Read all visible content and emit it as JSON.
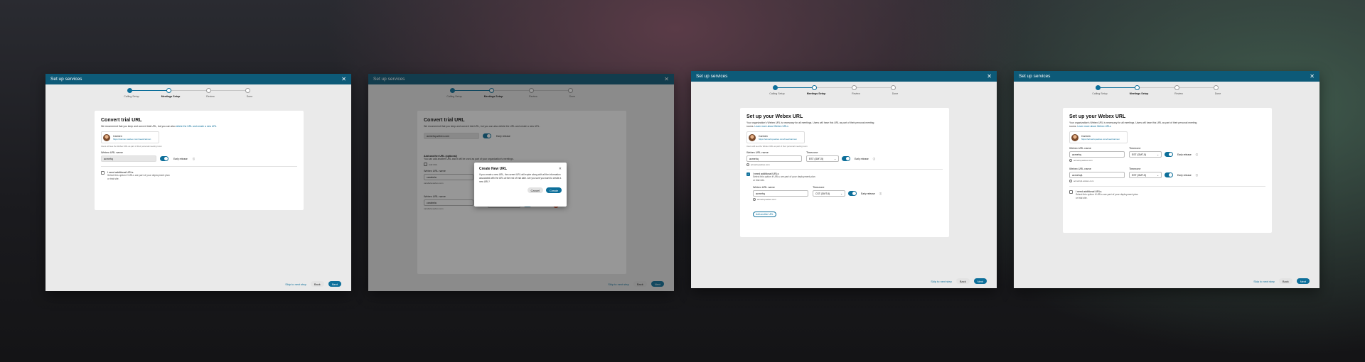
{
  "colors": {
    "accent": "#0d6f9a",
    "header": "#0d5a78"
  },
  "header_title": "Set up services",
  "steps": [
    "Calling Setup",
    "Meetings Setup",
    "Review",
    "Done"
  ],
  "footer": {
    "skip": "Skip to next step",
    "back": "Back",
    "next": "Next"
  },
  "panel1": {
    "title": "Convert trial URL",
    "desc": "We recommend that you keep and convert trial URL, but you can also",
    "desc_link": "delete the URL and create a new URL",
    "user_name": "Carmen",
    "user_url": "https://carmen.webex.com/meet/carmen",
    "user_note": "Users will see the Webex URL as part of their personal meeting room",
    "url_label": "Webex URL name",
    "url_value": "acmehq",
    "early": "Early release",
    "need_label": "I need additional URLs",
    "need_desc": "Select this option if URLs are part of your deployment plan or trial site."
  },
  "panel2": {
    "title": "Convert trial URL",
    "desc": "We recommend that you keep and convert trial URL, but you can also delete the URL and create a new URL.",
    "url_value": "acmehq.webex.com",
    "early": "Early release",
    "add_title": "Add another URL (optional)",
    "add_desc": "You can add another URL and it will be used as part of your organization's meetings.",
    "add_url": "Add URL",
    "url_label": "Webex URL name",
    "url_val2": "carabela",
    "hint": "carabela.webex.com",
    "tz_label": "Timezone",
    "tz": "EST (GMT-5)",
    "modal_title": "Create New URL",
    "modal_body": "If you create a new URL, the current URL will expire along with all the information associated with the URL at the end of trial date. Are you sure you want to create a new URL?",
    "cancel": "Cancel",
    "create": "Create"
  },
  "panel3": {
    "title": "Set up your Webex URL",
    "desc": "Your organization's Webex URL is necessary for all meetings. Users will have this URL as part of their personal meeting rooms.",
    "desc_link": "Learn more about Webex URLs",
    "user_name": "Carmen",
    "user_url": "https://acmehq.webex.com/meet/carmen",
    "user_note": "Users will see the Webex URL as part of their personal meeting room",
    "url_label": "Webex URL name",
    "url_value": "acmehq",
    "tz_label": "Timezone",
    "tz": "EST (GMT-5)",
    "early": "Early release",
    "hint": "acmehq.webex.com",
    "need_label": "I need additional URLs",
    "need_desc": "Select this option if URLs are part of your deployment plan or trial site.",
    "url2_label": "Webex URL name",
    "url2_value": "acmehq",
    "tz2_label": "Timezone",
    "tz2": "CST (GMT-6)",
    "hint2": "acmehq.webex.com",
    "add_btn": "Add another URL"
  },
  "panel4": {
    "title": "Set up your Webex URL",
    "desc": "Your organization's Webex URL is necessary for all meetings. Users will have this URL as part of their personal meeting rooms.",
    "desc_link": "Learn more about Webex URLs",
    "user_name": "Carmen",
    "user_url": "https://acmehq.webex.com/meet/carmen",
    "url_label": "Webex URL name",
    "url_value": "acmehq",
    "tz_label": "Timezone",
    "tz": "EST (GMT-5)",
    "early": "Early release",
    "hint": "acmehq.webex.com",
    "url2_value": "acmehq1",
    "tz2": "EST (GMT-5)",
    "hint2": "acmehq1.webex.com",
    "need_label": "I need additional URLs",
    "need_desc": "Select this option if URLs are part of your deployment plan or trial site."
  }
}
